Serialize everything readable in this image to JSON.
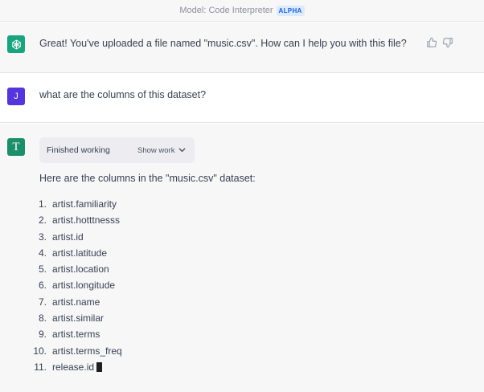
{
  "header": {
    "model_label": "Model: Code Interpreter",
    "badge": "ALPHA"
  },
  "messages": {
    "assistant_greeting": "Great! You've uploaded a file named \"music.csv\". How can I help you with this file?",
    "user_initial": "J",
    "user_question": "what are the columns of this dataset?",
    "plugin_initial": "T",
    "work_status": "Finished working",
    "show_work_label": "Show work",
    "answer_intro": "Here are the columns in the \"music.csv\" dataset:"
  },
  "columns": [
    {
      "num": "1.",
      "name": "artist.familiarity"
    },
    {
      "num": "2.",
      "name": "artist.hotttnesss"
    },
    {
      "num": "3.",
      "name": "artist.id"
    },
    {
      "num": "4.",
      "name": "artist.latitude"
    },
    {
      "num": "5.",
      "name": "artist.location"
    },
    {
      "num": "6.",
      "name": "artist.longitude"
    },
    {
      "num": "7.",
      "name": "artist.name"
    },
    {
      "num": "8.",
      "name": "artist.similar"
    },
    {
      "num": "9.",
      "name": "artist.terms"
    },
    {
      "num": "10.",
      "name": "artist.terms_freq"
    },
    {
      "num": "11.",
      "name": "release.id"
    }
  ],
  "icons": {
    "assistant_avatar": "openai-logo-icon",
    "thumbs_up": "thumbs-up-icon",
    "thumbs_down": "thumbs-down-icon",
    "chevron": "chevron-down-icon"
  },
  "colors": {
    "assistant_avatar": "#19a37f",
    "user_avatar": "#5436da",
    "plugin_avatar": "#1c8f6a",
    "badge_bg": "#dbeafe",
    "badge_text": "#1e60d4"
  }
}
